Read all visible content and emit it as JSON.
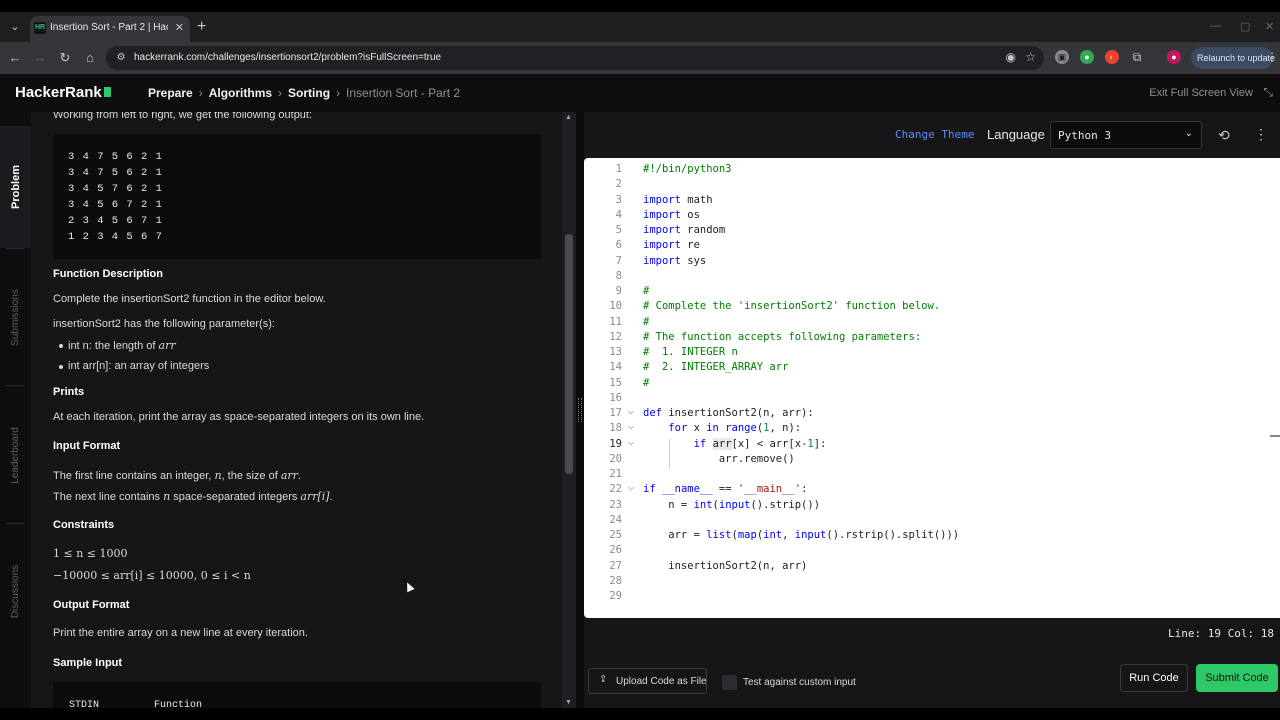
{
  "browser": {
    "tab_title": "Insertion Sort - Part 2 | HackerR",
    "favicon_text": "HR",
    "url": "hackerrank.com/challenges/insertionsort2/problem?isFullScreen=true",
    "relaunch_label": "Relaunch to update"
  },
  "header": {
    "logo": "HackerRank",
    "breadcrumbs": [
      "Prepare",
      "Algorithms",
      "Sorting",
      "Insertion Sort - Part 2"
    ],
    "exit_fullscreen": "Exit Full Screen View"
  },
  "vertical_tabs": [
    "Problem",
    "Submissions",
    "Leaderboard",
    "Discussions"
  ],
  "problem": {
    "intro_text": "Working from left to right, we get the following output:",
    "output_lines": [
      "3 4 7 5 6 2 1",
      "3 4 7 5 6 2 1",
      "3 4 5 7 6 2 1",
      "3 4 5 6 7 2 1",
      "2 3 4 5 6 7 1",
      "1 2 3 4 5 6 7"
    ],
    "function_description_heading": "Function Description",
    "function_description_text": "Complete the insertionSort2 function in the editor below.",
    "params_intro": "insertionSort2 has the following parameter(s):",
    "param_1_text": "int n: the length of ",
    "param_1_var": "arr",
    "param_2_text": "int arr[n]: an array of integers",
    "prints_heading": "Prints",
    "prints_text": "At each iteration, print the array as space-separated integers on its own line.",
    "input_format_heading": "Input Format",
    "input_line_1_a": "The first line contains an integer, ",
    "input_line_1_var1": "n",
    "input_line_1_b": ", the size of ",
    "input_line_1_var2": "arr",
    "input_line_1_c": ".",
    "input_line_2_a": "The next line contains ",
    "input_line_2_var1": "n",
    "input_line_2_b": " space-separated integers ",
    "input_line_2_var2": "arr[i]",
    "input_line_2_c": ".",
    "constraints_heading": "Constraints",
    "constraint_1": "1 ≤ n ≤ 1000",
    "constraint_2": "−10000 ≤ arr[i] ≤ 10000, 0 ≤ i < n",
    "output_format_heading": "Output Format",
    "output_format_text": "Print the entire array on a new line at every iteration.",
    "sample_input_heading": "Sample Input",
    "sample_col_1": "STDIN",
    "sample_col_2": "Function"
  },
  "editor": {
    "change_theme": "Change Theme",
    "language_label": "Language",
    "language_value": "Python 3",
    "status": "Line: 19 Col: 18",
    "upload_label": "Upload Code as File",
    "custom_input_label": "Test against custom input",
    "run_label": "Run Code",
    "submit_label": "Submit Code"
  },
  "colors": {
    "brand_green": "#2ec866",
    "link_blue": "#5b8cf5",
    "keyword": "#0000ff",
    "comment": "#008000"
  }
}
